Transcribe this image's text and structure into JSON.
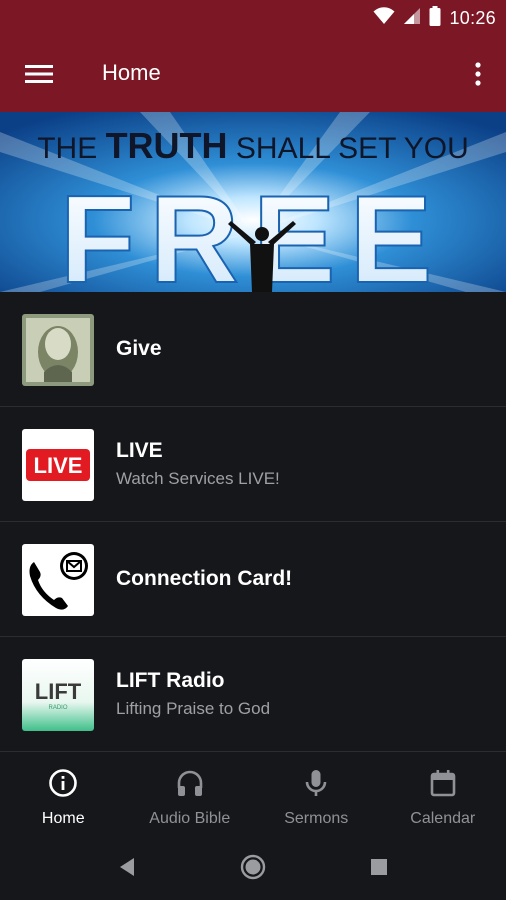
{
  "status_bar": {
    "time": "10:26",
    "icons": [
      "wifi-icon",
      "cell-signal-icon",
      "battery-icon"
    ]
  },
  "app_bar": {
    "title": "Home",
    "menu_icon": "hamburger-menu-icon",
    "more_icon": "more-vert-icon"
  },
  "banner": {
    "line1_a": "THE",
    "line1_b": "TRUTH",
    "line1_c": "SHALL SET YOU",
    "headline": "FREE"
  },
  "list": [
    {
      "title": "Give",
      "subtitle": "",
      "thumb": "dollar-bill-thumbnail"
    },
    {
      "title": "LIVE",
      "subtitle": "Watch Services LIVE!",
      "thumb": "live-badge-thumbnail",
      "thumb_text": "LIVE"
    },
    {
      "title": "Connection Card!",
      "subtitle": "",
      "thumb": "phone-message-thumbnail"
    },
    {
      "title": "LIFT Radio",
      "subtitle": "Lifting Praise to God",
      "thumb": "lift-radio-logo-thumbnail",
      "thumb_text": "LIFT",
      "thumb_small": "RADIO"
    }
  ],
  "bottom_nav": {
    "tabs": [
      {
        "label": "Home",
        "icon": "info-circle-icon",
        "active": true
      },
      {
        "label": "Audio Bible",
        "icon": "headphones-icon",
        "active": false
      },
      {
        "label": "Sermons",
        "icon": "microphone-icon",
        "active": false
      },
      {
        "label": "Calendar",
        "icon": "calendar-icon",
        "active": false
      }
    ]
  },
  "colors": {
    "brand": "#7c1726",
    "background": "#16171a",
    "divider": "#2b2d31",
    "subtitle": "#9ea0a5"
  }
}
